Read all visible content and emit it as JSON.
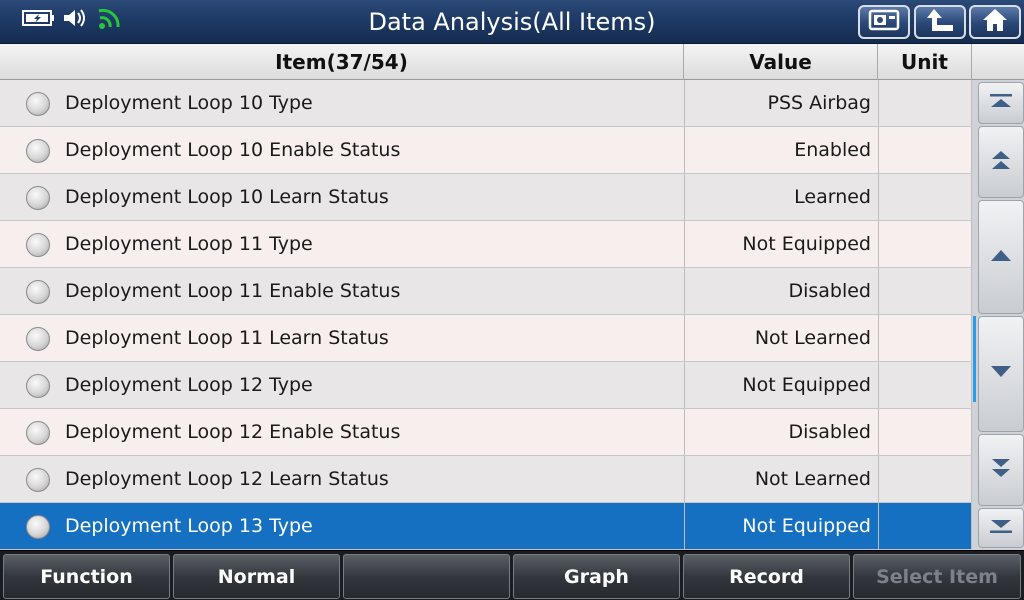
{
  "header": {
    "title": "Data Analysis(All Items)",
    "status_icons": [
      "battery-charging-icon",
      "speaker-icon",
      "wifi-icon"
    ],
    "buttons": [
      "screenshot-icon",
      "back-arrow-icon",
      "home-icon"
    ]
  },
  "table": {
    "columns": {
      "item": "Item(37/54)",
      "value": "Value",
      "unit": "Unit"
    },
    "rows": [
      {
        "name": "Deployment Loop 10 Type",
        "value": "PSS Airbag",
        "unit": ""
      },
      {
        "name": "Deployment Loop 10 Enable Status",
        "value": "Enabled",
        "unit": ""
      },
      {
        "name": "Deployment Loop 10 Learn Status",
        "value": "Learned",
        "unit": ""
      },
      {
        "name": "Deployment Loop 11 Type",
        "value": "Not Equipped",
        "unit": ""
      },
      {
        "name": "Deployment Loop 11 Enable Status",
        "value": "Disabled",
        "unit": ""
      },
      {
        "name": "Deployment Loop 11 Learn Status",
        "value": "Not Learned",
        "unit": ""
      },
      {
        "name": "Deployment Loop 12 Type",
        "value": "Not Equipped",
        "unit": ""
      },
      {
        "name": "Deployment Loop 12 Enable Status",
        "value": "Disabled",
        "unit": ""
      },
      {
        "name": "Deployment Loop 12 Learn Status",
        "value": "Not Learned",
        "unit": ""
      },
      {
        "name": "Deployment Loop 13 Type",
        "value": "Not Equipped",
        "unit": "",
        "selected": true
      }
    ]
  },
  "scroll": {
    "buttons": [
      "scroll-to-top-icon",
      "page-up-icon",
      "line-up-icon",
      "line-down-icon",
      "page-down-icon",
      "scroll-to-bottom-icon"
    ]
  },
  "footer": {
    "buttons": [
      "Function",
      "Normal",
      "",
      "Graph",
      "Record",
      "Select Item"
    ],
    "disabled": [
      false,
      false,
      false,
      false,
      false,
      true
    ]
  },
  "colors": {
    "selected_row": "#1570c2",
    "row_odd": "#e8e6e7",
    "row_even": "#f7efee",
    "header_bar": "#1e3a66",
    "scroll_indicator": "#2a9be8"
  }
}
